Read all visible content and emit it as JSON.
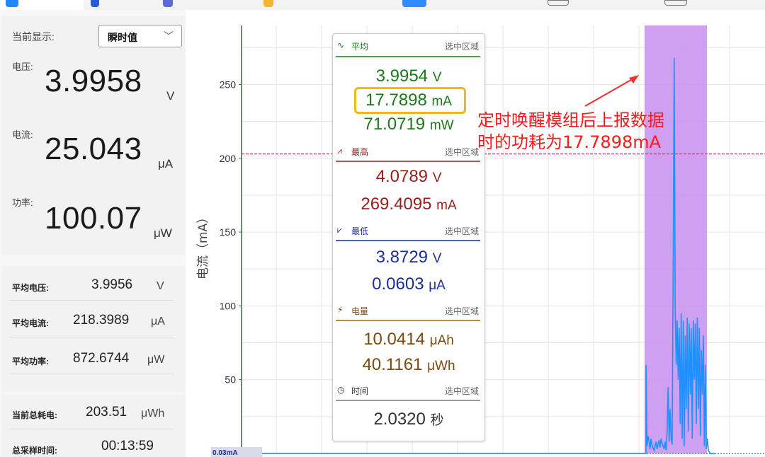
{
  "left": {
    "display_label": "当前显示:",
    "display_mode": "瞬时值",
    "voltage": {
      "label": "电压:",
      "value": "3.9958",
      "unit": "V"
    },
    "current": {
      "label": "电流:",
      "value": "25.043",
      "unit": "μA"
    },
    "power": {
      "label": "功率:",
      "value": "100.07",
      "unit": "μW"
    },
    "avg": [
      {
        "label": "平均电压:",
        "value": "3.9956",
        "unit": "V"
      },
      {
        "label": "平均电流:",
        "value": "218.3989",
        "unit": "μA"
      },
      {
        "label": "平均功率:",
        "value": "872.6744",
        "unit": "μW"
      }
    ],
    "totals": [
      {
        "label": "当前总耗电:",
        "value": "203.51",
        "unit": "μWh"
      },
      {
        "label": "总采样时间:",
        "value": "00:13:59",
        "unit": ""
      }
    ]
  },
  "stats": {
    "avg": {
      "title": "平均",
      "scope": "选中区域",
      "icon": "average-icon",
      "voltage": "3.9954",
      "voltage_unit": "V",
      "current": "17.7898",
      "current_unit": "mA",
      "power": "71.0719",
      "power_unit": "mW",
      "color": "#1a7a1a"
    },
    "max": {
      "title": "最高",
      "scope": "选中区域",
      "icon": "max-icon",
      "voltage": "4.0789",
      "voltage_unit": "V",
      "current": "269.4095",
      "current_unit": "mA",
      "color": "#9b1c1c"
    },
    "min": {
      "title": "最低",
      "scope": "选中区域",
      "icon": "min-icon",
      "voltage": "3.8729",
      "voltage_unit": "V",
      "current": "0.0603",
      "current_unit": "μA",
      "color": "#1c2f9b"
    },
    "energy": {
      "title": "电量",
      "scope": "选中区域",
      "icon": "energy-icon",
      "charge": "10.0414",
      "charge_unit": "μAh",
      "energy": "40.1161",
      "energy_unit": "μWh",
      "color": "#7a4a12"
    },
    "time": {
      "title": "时间",
      "scope": "选中区域",
      "icon": "clock-icon",
      "value": "2.0320",
      "unit": "秒",
      "color": "#333333"
    }
  },
  "annotation": {
    "line1": "定时唤醒模组后上报数据",
    "line2": "时的功耗为17.7898mA",
    "color": "#ff1a1a"
  },
  "chart_data": {
    "type": "line",
    "ylabel": "电流（mA）",
    "y_ticks": [
      50,
      100,
      150,
      200,
      250
    ],
    "ylim": [
      0,
      290
    ],
    "bottom_label": "0.03mA",
    "threshold_line": 203,
    "selection_color": "#c78ff0",
    "series_color": "#1e90ff",
    "series": [
      {
        "values": [
          0.03,
          0.03,
          0.03,
          0.03,
          0.03,
          0.03,
          0.03,
          0.03,
          0.03,
          0.03,
          0.03,
          0.03,
          0.03,
          0.03,
          0.03,
          0.03,
          0.03,
          0.03,
          0.03,
          0.03,
          0.03,
          0.03,
          0.03,
          0.03,
          0.03,
          0.03,
          0.03,
          0.03,
          0.03,
          0.03,
          0.03,
          0.03,
          0.03,
          0.03,
          0.03,
          0.03,
          0.03,
          0.03,
          0.03,
          0.03,
          0.03,
          0.03,
          0.03,
          0.03,
          0.03,
          0.03,
          0.03,
          0.03,
          0.03,
          0.03,
          0.03,
          0.03,
          0.03,
          0.03,
          0.03,
          0.03,
          0.03,
          0.03,
          0.03,
          0.03,
          0.03,
          0.03,
          0.03,
          0.03,
          0.03,
          0.03,
          0.03,
          0.03,
          0.03,
          0.03,
          0.03,
          0.03,
          0.03,
          0.03,
          0.03,
          0.03,
          0.03,
          0.03,
          0.03,
          0.03,
          0.03,
          0.03,
          0.03,
          0.03,
          0.03,
          0.03,
          0.03,
          0.03,
          0.03,
          0.03,
          0.03,
          0.03,
          0.03,
          0.03,
          0.03,
          0.03,
          0.03,
          0.03,
          0.03,
          0.03,
          0.03,
          0.03,
          0.03,
          0.03,
          0.03,
          0.03,
          0.03,
          0.03,
          0.03,
          0.03,
          0.03,
          0.03,
          0.03,
          0.03,
          0.03,
          0.03,
          0.03,
          0.03,
          0.03,
          0.03,
          60,
          5,
          12,
          8,
          3,
          10,
          6,
          4,
          2,
          5,
          8,
          3,
          6,
          9,
          4,
          10,
          7,
          5,
          3,
          8,
          2,
          15,
          45,
          8,
          30,
          10,
          6,
          120,
          268,
          100,
          60,
          90,
          50,
          85,
          20,
          95,
          10,
          90,
          5,
          80,
          30,
          92,
          15,
          88,
          40,
          85,
          10,
          90,
          50,
          88,
          20,
          92,
          30,
          85,
          12,
          70,
          40,
          80,
          5,
          60,
          3,
          10,
          2,
          1,
          0.03,
          0.03,
          0.03,
          0.03,
          0.03,
          0.03
        ]
      }
    ]
  }
}
